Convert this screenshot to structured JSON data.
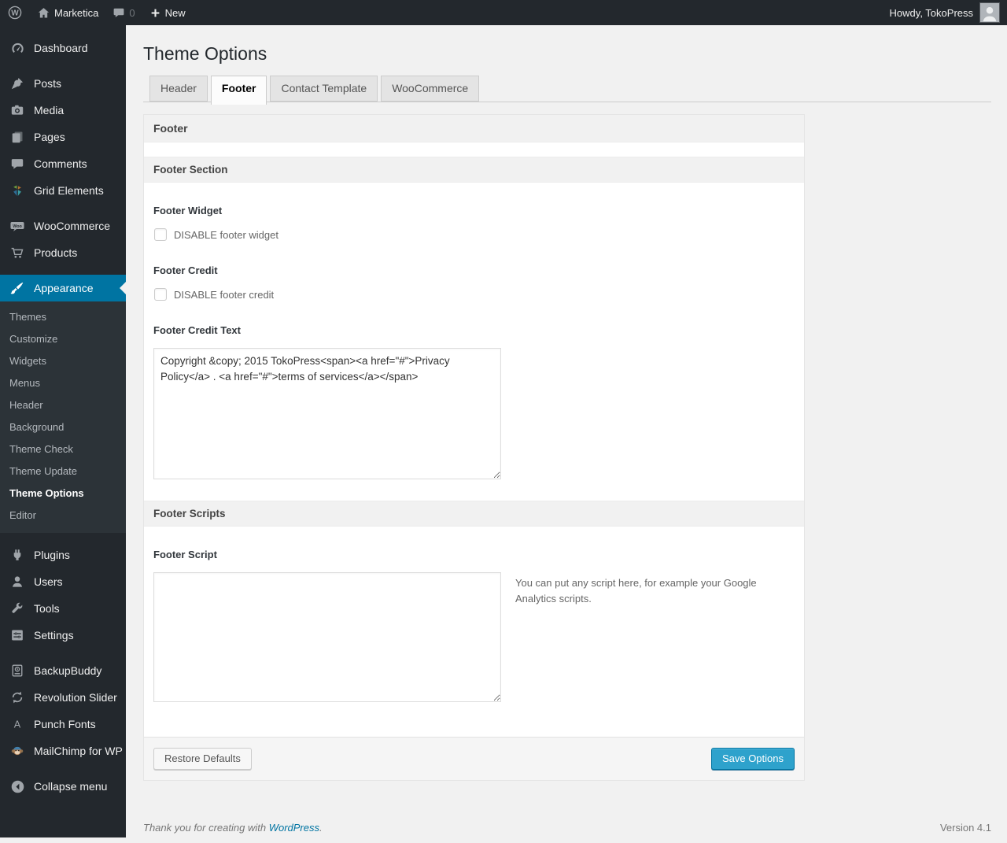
{
  "admin_bar": {
    "site_name": "Marketica",
    "comments_count": "0",
    "new_label": "New",
    "howdy": "Howdy, TokoPress"
  },
  "sidebar": {
    "items": [
      {
        "label": "Dashboard",
        "icon": "dashboard-icon"
      },
      {
        "label": "Posts",
        "icon": "pushpin-icon",
        "sep_before": true
      },
      {
        "label": "Media",
        "icon": "camera-icon"
      },
      {
        "label": "Pages",
        "icon": "pages-icon"
      },
      {
        "label": "Comments",
        "icon": "comment-bubble-icon"
      },
      {
        "label": "Grid Elements",
        "icon": "grid-elements-icon"
      },
      {
        "label": "WooCommerce",
        "icon": "woocommerce-icon",
        "sep_before": true
      },
      {
        "label": "Products",
        "icon": "cart-icon"
      },
      {
        "label": "Appearance",
        "icon": "paintbrush-icon",
        "sep_before": true,
        "active": true,
        "submenu": [
          "Themes",
          "Customize",
          "Widgets",
          "Menus",
          "Header",
          "Background",
          "Theme Check",
          "Theme Update",
          "Theme Options",
          "Editor"
        ],
        "current_submenu": "Theme Options"
      },
      {
        "label": "Plugins",
        "icon": "plug-icon",
        "sep_before": true
      },
      {
        "label": "Users",
        "icon": "user-icon"
      },
      {
        "label": "Tools",
        "icon": "wrench-icon"
      },
      {
        "label": "Settings",
        "icon": "sliders-icon"
      },
      {
        "label": "BackupBuddy",
        "icon": "backup-drive-icon",
        "sep_before": true
      },
      {
        "label": "Revolution Slider",
        "icon": "refresh-arrows-icon"
      },
      {
        "label": "Punch Fonts",
        "icon": "letter-a-icon"
      },
      {
        "label": "MailChimp for WP",
        "icon": "monkey-icon"
      },
      {
        "label": "Collapse menu",
        "icon": "collapse-arrow-icon",
        "sep_before": true
      }
    ]
  },
  "page": {
    "title": "Theme Options",
    "tabs": [
      {
        "label": "Header"
      },
      {
        "label": "Footer",
        "active": true
      },
      {
        "label": "Contact Template"
      },
      {
        "label": "WooCommerce"
      }
    ]
  },
  "panel": {
    "title": "Footer",
    "footer_section_title": "Footer Section",
    "footer_widget_label": "Footer Widget",
    "footer_widget_checkbox": "DISABLE footer widget",
    "footer_widget_checked": false,
    "footer_credit_label": "Footer Credit",
    "footer_credit_checkbox": "DISABLE footer credit",
    "footer_credit_checked": false,
    "footer_credit_text_label": "Footer Credit Text",
    "footer_credit_text_value": "Copyright &copy; 2015 TokoPress<span><a href=\"#\">Privacy Policy</a> . <a href=\"#\">terms of services</a></span>",
    "footer_scripts_title": "Footer Scripts",
    "footer_script_label": "Footer Script",
    "footer_script_value": "",
    "footer_script_help": "You can put any script here, for example your Google Analytics scripts.",
    "restore_button": "Restore Defaults",
    "save_button": "Save Options"
  },
  "footer": {
    "thanks": "Thank you for creating with",
    "wordpress": "WordPress",
    "suffix": ".",
    "version": "Version 4.1"
  },
  "colors": {
    "menu_highlight": "#0074a2",
    "primary_button": "#2ea2cc",
    "admin_bar_bg": "#23282d",
    "page_bg": "#f1f1f1"
  }
}
